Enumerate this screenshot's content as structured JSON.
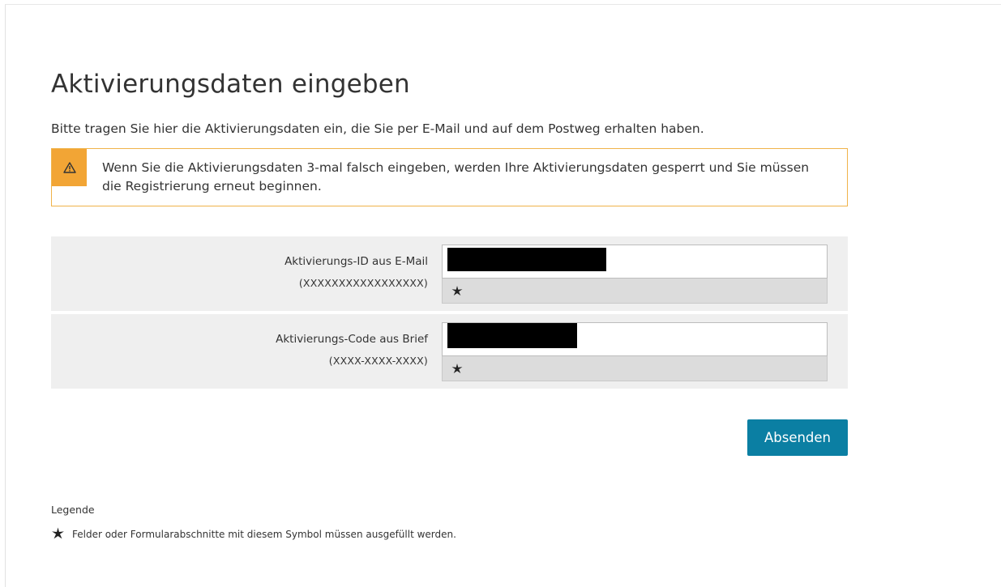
{
  "page": {
    "title": "Aktivierungsdaten eingeben",
    "intro": "Bitte tragen Sie hier die Aktivierungsdaten ein, die Sie per E-Mail und auf dem Postweg erhalten haben."
  },
  "warning": {
    "icon": "warning-triangle-icon",
    "text": "Wenn Sie die Aktivierungsdaten 3-mal falsch eingeben, werden Ihre Aktivierungsdaten gesperrt und Sie müssen die Registrierung erneut beginnen.",
    "accent_color": "#f2a535"
  },
  "form": {
    "fields": [
      {
        "label": "Aktivierungs-ID aus E-Mail",
        "hint": "(XXXXXXXXXXXXXXXXX)",
        "value": "",
        "required": true
      },
      {
        "label": "Aktivierungs-Code aus Brief",
        "hint": "(XXXX-XXXX-XXXX)",
        "value": "",
        "required": true
      }
    ],
    "submit_label": "Absenden",
    "submit_color": "#0b7fa3"
  },
  "legend": {
    "title": "Legende",
    "items": [
      {
        "icon": "asterisk-icon",
        "text": "Felder oder Formularabschnitte mit diesem Symbol müssen ausgefüllt werden."
      }
    ]
  }
}
